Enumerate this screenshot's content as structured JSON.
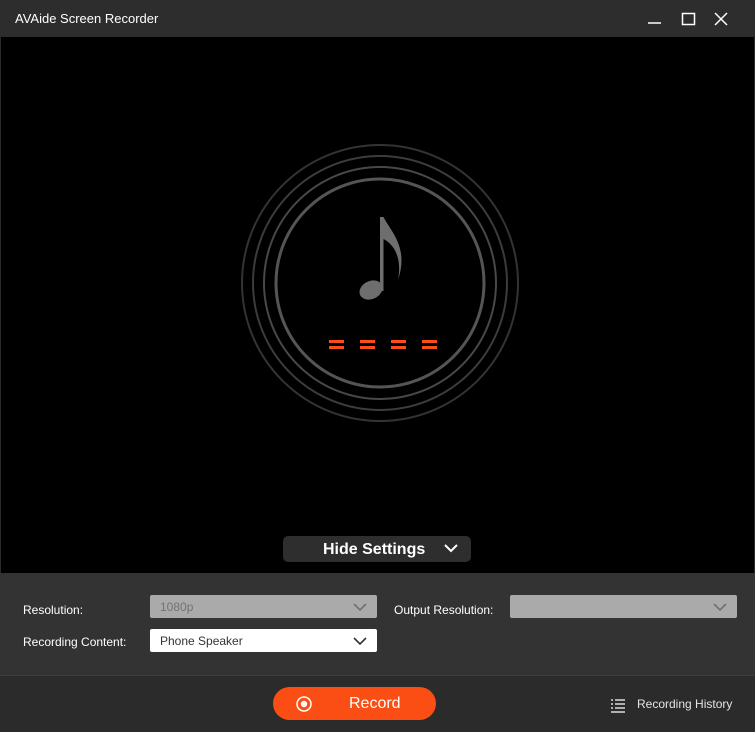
{
  "window": {
    "title": "AVAide Screen Recorder"
  },
  "colors": {
    "accent": "#fa4e15",
    "preview_bg": "#000000",
    "panel_bg": "#333333"
  },
  "icons": {
    "minimize": "minimize-icon",
    "maximize": "maximize-icon",
    "close": "close-icon",
    "music_note": "music-note-icon",
    "chevron": "chevron-down-icon",
    "record": "record-dot-icon",
    "history": "list-icon"
  },
  "preview": {
    "hide_settings_label": "Hide Settings"
  },
  "settings": {
    "resolution": {
      "label": "Resolution:",
      "value": "1080p",
      "disabled": true
    },
    "output_resolution": {
      "label": "Output Resolution:",
      "value": "",
      "disabled": true
    },
    "recording_content": {
      "label": "Recording Content:",
      "value": "Phone Speaker",
      "disabled": false
    }
  },
  "footer": {
    "record_label": "Record",
    "history_label": "Recording History"
  }
}
